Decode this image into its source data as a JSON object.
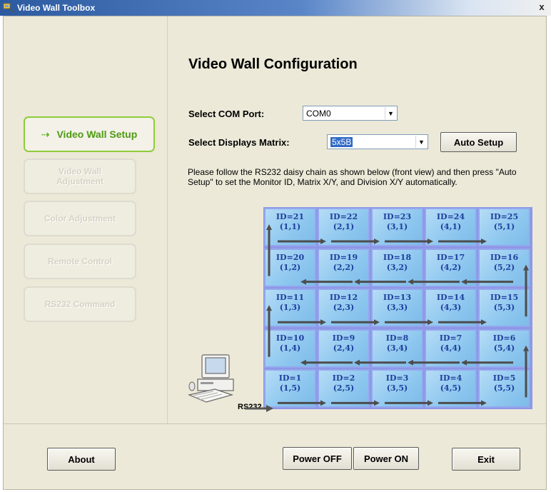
{
  "window": {
    "title": "Video Wall Toolbox",
    "close_label": "x"
  },
  "sidebar": {
    "items": [
      {
        "label": "Video Wall Setup",
        "active": true
      },
      {
        "label": "Video Wall Adjustment",
        "active": false
      },
      {
        "label": "Color Adjustment",
        "active": false
      },
      {
        "label": "Remote Control",
        "active": false
      },
      {
        "label": "RS232 Command",
        "active": false
      }
    ]
  },
  "main": {
    "heading": "Video Wall Configuration",
    "com_port": {
      "label": "Select COM Port:",
      "value": "COM0"
    },
    "matrix": {
      "label": "Select Displays Matrix:",
      "value": "5x5B"
    },
    "auto_setup_label": "Auto Setup",
    "instructions": "Please follow the RS232 daisy chain as shown below (front view) and then press \"Auto Setup\" to set the Monitor ID, Matrix X/Y, and Division X/Y automatically.",
    "rs232_label": "RS232",
    "grid": [
      [
        {
          "id": "ID=21",
          "pos": "(1,1)"
        },
        {
          "id": "ID=22",
          "pos": "(2,1)"
        },
        {
          "id": "ID=23",
          "pos": "(3,1)"
        },
        {
          "id": "ID=24",
          "pos": "(4,1)"
        },
        {
          "id": "ID=25",
          "pos": "(5,1)"
        }
      ],
      [
        {
          "id": "ID=20",
          "pos": "(1,2)"
        },
        {
          "id": "ID=19",
          "pos": "(2,2)"
        },
        {
          "id": "ID=18",
          "pos": "(3,2)"
        },
        {
          "id": "ID=17",
          "pos": "(4,2)"
        },
        {
          "id": "ID=16",
          "pos": "(5,2)"
        }
      ],
      [
        {
          "id": "ID=11",
          "pos": "(1,3)"
        },
        {
          "id": "ID=12",
          "pos": "(2,3)"
        },
        {
          "id": "ID=13",
          "pos": "(3,3)"
        },
        {
          "id": "ID=14",
          "pos": "(4,3)"
        },
        {
          "id": "ID=15",
          "pos": "(5,3)"
        }
      ],
      [
        {
          "id": "ID=10",
          "pos": "(1,4)"
        },
        {
          "id": "ID=9",
          "pos": "(2,4)"
        },
        {
          "id": "ID=8",
          "pos": "(3,4)"
        },
        {
          "id": "ID=7",
          "pos": "(4,4)"
        },
        {
          "id": "ID=6",
          "pos": "(5,4)"
        }
      ],
      [
        {
          "id": "ID=1",
          "pos": "(1,5)"
        },
        {
          "id": "ID=2",
          "pos": "(2,5)"
        },
        {
          "id": "ID=3",
          "pos": "(3,5)"
        },
        {
          "id": "ID=4",
          "pos": "(4,5)"
        },
        {
          "id": "ID=5",
          "pos": "(5,5)"
        }
      ]
    ]
  },
  "footer": {
    "about_label": "About",
    "power_off_label": "Power OFF",
    "power_on_label": "Power ON",
    "exit_label": "Exit"
  },
  "colors": {
    "active_nav": "#4e9a10",
    "cell_text": "#1e3e9c",
    "cell_fill": "#8dc7ef"
  }
}
